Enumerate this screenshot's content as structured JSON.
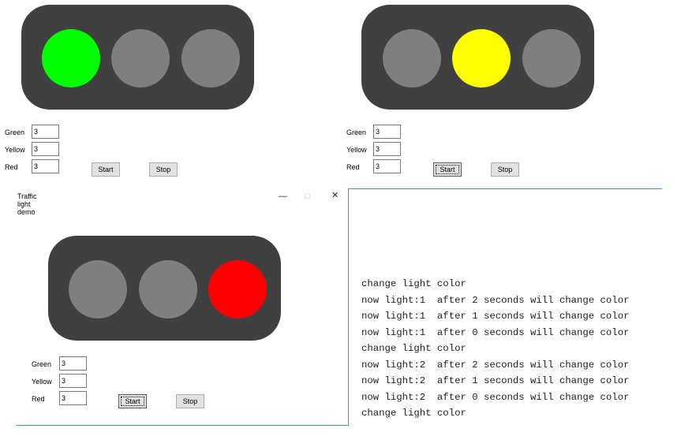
{
  "colors": {
    "housing": "#404040",
    "lamp_off": "#7f7f7f",
    "green_on": "#00ff00",
    "yellow_on": "#ffff00",
    "red_on": "#ff0000",
    "window_border": "#3d8ee0"
  },
  "panels": [
    {
      "active_light": "green",
      "green_label": "Green",
      "green_value": "3",
      "yellow_label": "Yellow",
      "yellow_value": "3",
      "red_label": "Red",
      "red_value": "3",
      "start_label": "Start",
      "stop_label": "Stop"
    },
    {
      "active_light": "yellow",
      "green_label": "Green",
      "green_value": "3",
      "yellow_label": "Yellow",
      "yellow_value": "3",
      "red_label": "Red",
      "red_value": "3",
      "start_label": "Start",
      "stop_label": "Stop"
    },
    {
      "active_light": "red",
      "window_title": "Traffic light demo",
      "minimize_icon": "minimize-icon",
      "maximize_icon": "maximize-icon",
      "close_icon": "close-icon",
      "green_label": "Green",
      "green_value": "3",
      "yellow_label": "Yellow",
      "yellow_value": "3",
      "red_label": "Red",
      "red_value": "3",
      "start_label": "Start",
      "stop_label": "Stop"
    }
  ],
  "console": {
    "lines": [
      "change light color",
      "now light:1  after 2 seconds will change color",
      "now light:1  after 1 seconds will change color",
      "now light:1  after 0 seconds will change color",
      "change light color",
      "now light:2  after 2 seconds will change color",
      "now light:2  after 1 seconds will change color",
      "now light:2  after 0 seconds will change color",
      "change light color"
    ]
  }
}
